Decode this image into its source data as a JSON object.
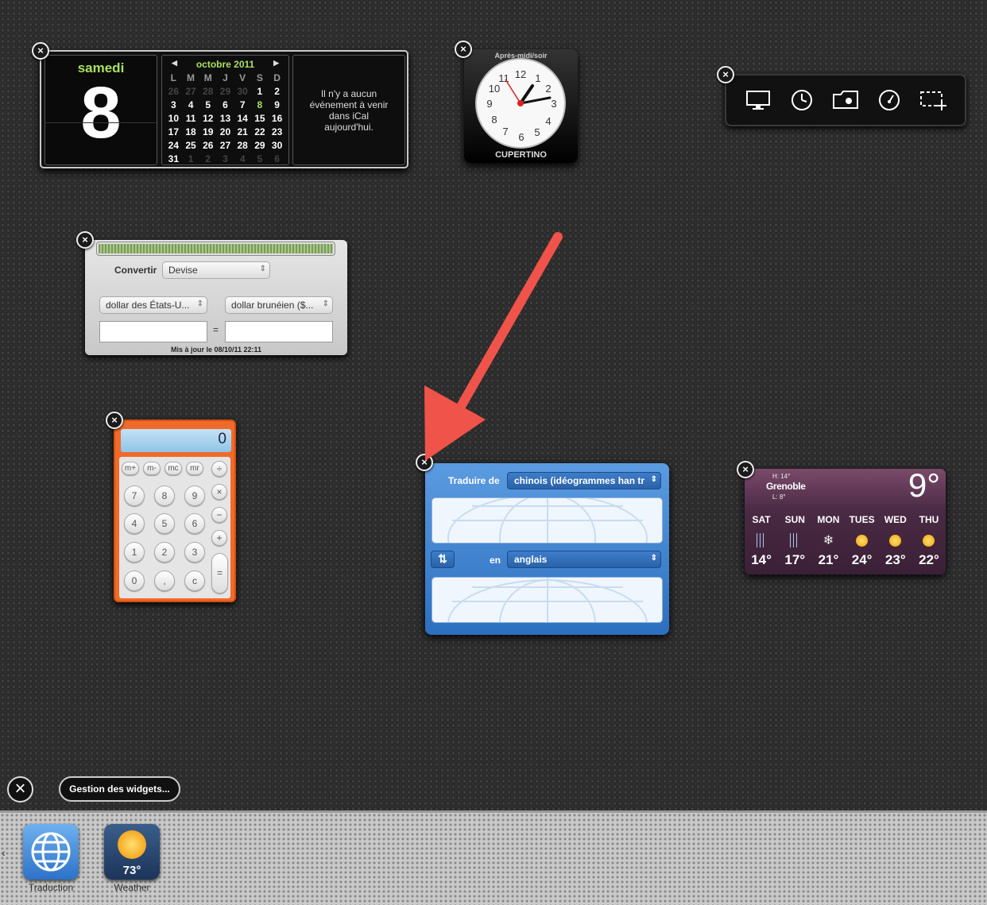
{
  "calendar": {
    "day_name": "samedi",
    "day_number": "8",
    "month_label": "octobre 2011",
    "weekday_headers": [
      "L",
      "M",
      "M",
      "J",
      "V",
      "S",
      "D"
    ],
    "weeks": [
      [
        "26",
        "27",
        "28",
        "29",
        "30",
        "1",
        "2"
      ],
      [
        "3",
        "4",
        "5",
        "6",
        "7",
        "8",
        "9"
      ],
      [
        "10",
        "11",
        "12",
        "13",
        "14",
        "15",
        "16"
      ],
      [
        "17",
        "18",
        "19",
        "20",
        "21",
        "22",
        "23"
      ],
      [
        "24",
        "25",
        "26",
        "27",
        "28",
        "29",
        "30"
      ],
      [
        "31",
        "1",
        "2",
        "3",
        "4",
        "5",
        "6"
      ]
    ],
    "events_text": "Il n'y a aucun événement à venir dans iCal aujourd'hui."
  },
  "clock": {
    "period_label": "Après-midi/soir",
    "city": "CUPERTINO",
    "numerals": [
      "12",
      "1",
      "2",
      "3",
      "4",
      "5",
      "6",
      "7",
      "8",
      "9",
      "10",
      "11"
    ]
  },
  "converter": {
    "convert_label": "Convertir",
    "category": "Devise",
    "from_currency": "dollar des États-U...",
    "to_currency": "dollar brunéien ($...",
    "equals": "=",
    "updated": "Mis à jour le 08/10/11 22:11"
  },
  "calculator": {
    "display": "0",
    "keys": [
      "m+",
      "m-",
      "mc",
      "mr",
      "÷",
      "7",
      "8",
      "9",
      "×",
      "4",
      "5",
      "6",
      "−",
      "1",
      "2",
      "3",
      "+",
      "0",
      ",",
      "c",
      "="
    ]
  },
  "translator": {
    "from_label": "Traduire de",
    "from_lang": "chinois (idéogrammes han tr",
    "swap_icon": "swap-icon",
    "to_label": "en",
    "to_lang": "anglais"
  },
  "weather": {
    "high": "H: 14°",
    "city": "Grenoble",
    "low": "L: 8°",
    "current_temp": "9°",
    "forecast": [
      {
        "day": "SAT",
        "temp": "14°",
        "icon": "rain"
      },
      {
        "day": "SUN",
        "temp": "17°",
        "icon": "rain"
      },
      {
        "day": "MON",
        "temp": "21°",
        "icon": "snow"
      },
      {
        "day": "TUES",
        "temp": "24°",
        "icon": "sun"
      },
      {
        "day": "WED",
        "temp": "23°",
        "icon": "sun"
      },
      {
        "day": "THU",
        "temp": "22°",
        "icon": "sun"
      }
    ]
  },
  "bottom": {
    "close_all_icon": "close-icon",
    "manage_label": "Gestion des widgets..."
  },
  "tray": {
    "items": [
      {
        "label": "Traduction",
        "icon": "globe-icon"
      },
      {
        "label": "Weather",
        "icon": "sun-icon",
        "badge": "73°"
      }
    ]
  },
  "colors": {
    "accent_green": "#a8e060",
    "annotation_arrow": "#f0534a"
  }
}
